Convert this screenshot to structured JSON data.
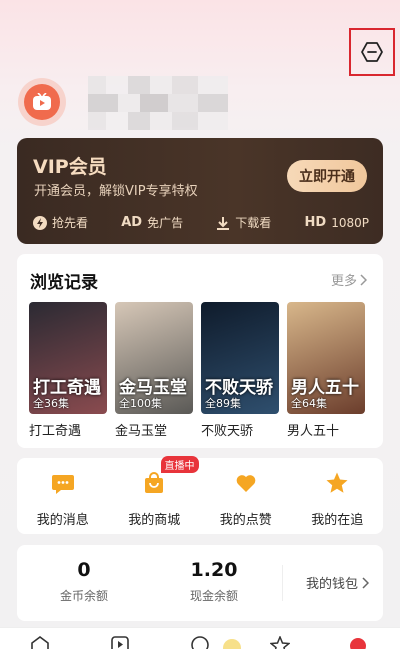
{
  "vip": {
    "title": "VIP会员",
    "subtitle": "开通会员，解锁VIP专享特权",
    "open_label": "立即开通",
    "perks": [
      {
        "label": "抢先看",
        "icon": "lightning-icon"
      },
      {
        "label": "免广告",
        "icon": "ad-icon",
        "tag": "AD"
      },
      {
        "label": "下载看",
        "icon": "download-icon"
      },
      {
        "label": "1080P",
        "icon": "hd-icon",
        "tag": "HD"
      }
    ]
  },
  "history": {
    "title": "浏览记录",
    "more_label": "更多",
    "items": [
      {
        "name": "打工奇遇",
        "episodes": "全36集",
        "overlay": "打工奇遇",
        "color_a": "#8a4b4f",
        "color_b": "#2b2a33"
      },
      {
        "name": "金马玉堂",
        "episodes": "全100集",
        "overlay": "金马玉堂",
        "color_a": "#5a5956",
        "color_b": "#d6c7b7"
      },
      {
        "name": "不败天骄",
        "episodes": "全89集",
        "overlay": "不败天骄",
        "color_a": "#2f4f6e",
        "color_b": "#0f1b2b"
      },
      {
        "name": "男人五十",
        "episodes": "全64集",
        "overlay": "男人五十",
        "color_a": "#6b3d2c",
        "color_b": "#d8b78b"
      }
    ]
  },
  "shortcuts": [
    {
      "label": "我的消息",
      "icon": "message-icon"
    },
    {
      "label": "我的商城",
      "icon": "shopping-bag-icon",
      "badge": "直播中"
    },
    {
      "label": "我的点赞",
      "icon": "heart-icon"
    },
    {
      "label": "我的在追",
      "icon": "star-icon"
    }
  ],
  "wallet": {
    "coins_value": "0",
    "coins_label": "金币余额",
    "cash_value": "1.20",
    "cash_label": "现金余额",
    "link_label": "我的钱包"
  },
  "colors": {
    "accent": "#f5a623",
    "vip_bg": "#3d2c23",
    "highlight_frame": "#d9272f",
    "live_badge": "#e8343b"
  }
}
